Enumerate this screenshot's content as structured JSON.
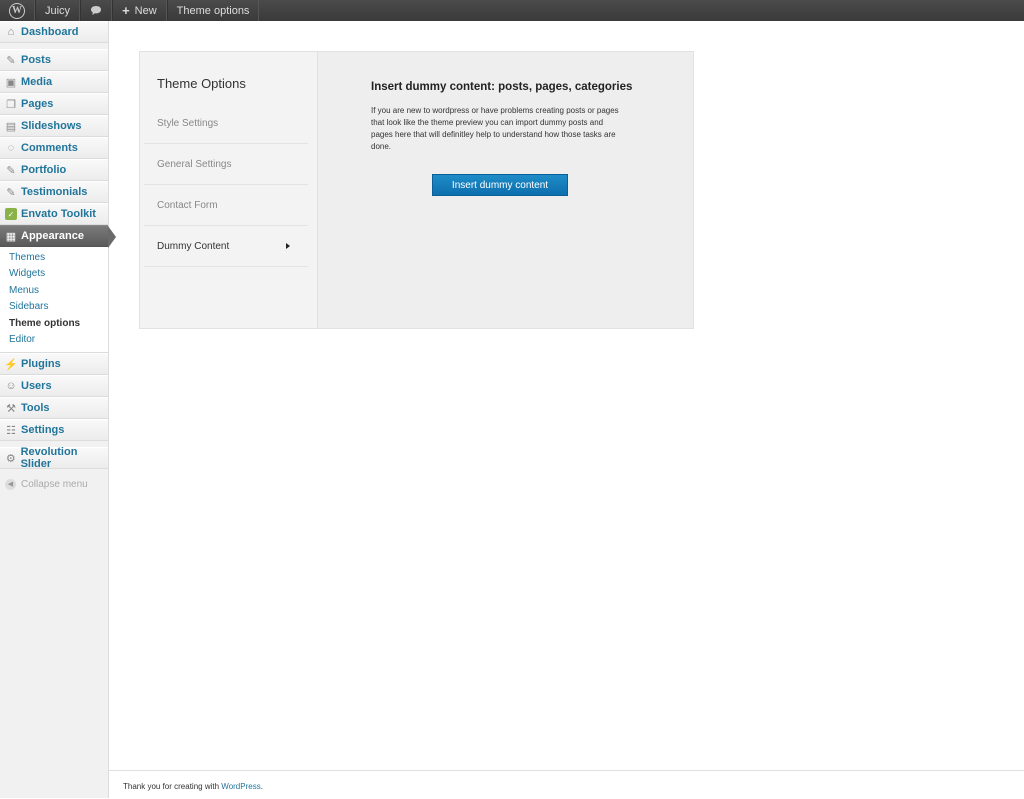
{
  "admin_bar": {
    "site_name": "Juicy",
    "new_label": "New",
    "theme_options_label": "Theme options"
  },
  "sidebar": {
    "items": [
      {
        "label": "Dashboard",
        "icon": "house-icon"
      },
      {
        "label": "Posts",
        "icon": "pushpin-icon"
      },
      {
        "label": "Media",
        "icon": "media-icon"
      },
      {
        "label": "Pages",
        "icon": "pages-icon"
      },
      {
        "label": "Slideshows",
        "icon": "slideshow-icon"
      },
      {
        "label": "Comments",
        "icon": "comment-icon"
      },
      {
        "label": "Portfolio",
        "icon": "pushpin-icon"
      },
      {
        "label": "Testimonials",
        "icon": "pushpin-icon"
      },
      {
        "label": "Envato Toolkit",
        "icon": "envato-icon"
      },
      {
        "label": "Appearance",
        "icon": "appearance-icon"
      }
    ],
    "submenu": [
      "Themes",
      "Widgets",
      "Menus",
      "Sidebars",
      "Theme options",
      "Editor"
    ],
    "items2": [
      {
        "label": "Plugins",
        "icon": "plug-icon"
      },
      {
        "label": "Users",
        "icon": "users-icon"
      },
      {
        "label": "Tools",
        "icon": "tools-icon"
      },
      {
        "label": "Settings",
        "icon": "settings-icon"
      }
    ],
    "revolution_slider": "Revolution Slider",
    "collapse_menu": "Collapse menu"
  },
  "options": {
    "title": "Theme Options",
    "nav": [
      "Style Settings",
      "General Settings",
      "Contact Form",
      "Dummy Content"
    ],
    "content_title": "Insert dummy content: posts, pages, categories",
    "content_description": "If you are new to wordpress or have problems creating posts or pages that look like the theme preview you can import dummy posts and pages here that will definitley help to understand how those tasks are done.",
    "button_label": "Insert dummy content"
  },
  "footer": {
    "text": "Thank you for creating with ",
    "link": "WordPress",
    "suffix": "."
  },
  "colors": {
    "link_blue": "#21759b",
    "button_blue": "#1e8cc8",
    "admin_bar": "#464646"
  }
}
